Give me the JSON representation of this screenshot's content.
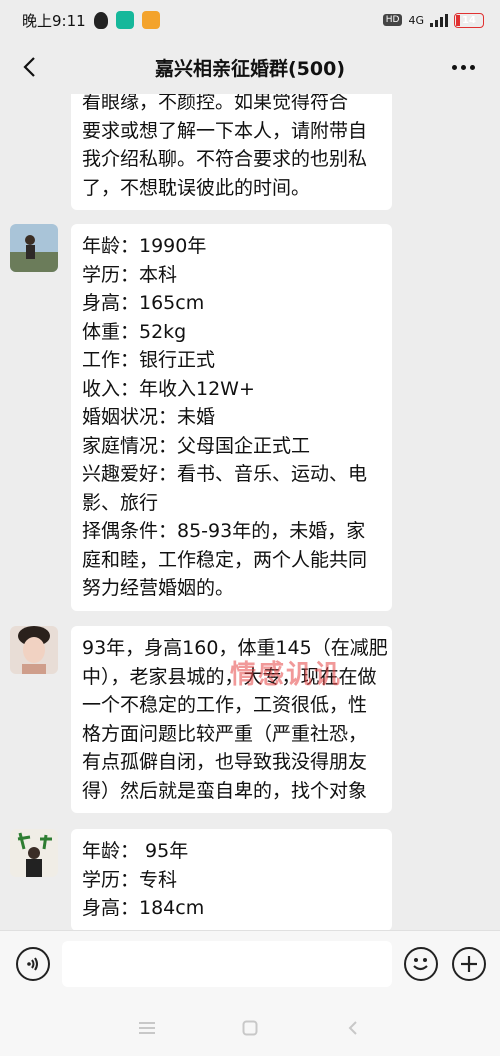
{
  "status_bar": {
    "time": "晚上9:11",
    "hd": "HD",
    "network": "4G",
    "battery": "14",
    "battery_level": 0.14
  },
  "header": {
    "title": "嘉兴相亲征婚群(500)"
  },
  "messages": [
    {
      "lines": [
        "看眼缘，不颜控。如果觉得符合",
        "要求或想了解一下本人，请附带自",
        "我介绍私聊。不符合要求的也别私",
        "了，不想耽误彼此的时间。"
      ]
    },
    {
      "lines": [
        "年龄：1990年",
        "学历：本科",
        "身高：165cm",
        "体重：52kg",
        "工作：银行正式",
        "收入：年收入12W+",
        "婚姻状况：未婚",
        "家庭情况：父母国企正式工",
        "兴趣爱好：看书、音乐、运动、电",
        "影、旅行",
        "择偶条件：85-93年的，未婚，家",
        "庭和睦，工作稳定，两个人能共同",
        "努力经营婚姻的。"
      ]
    },
    {
      "lines": [
        "93年，身高160，体重145（在减肥",
        "中），老家县城的，大专，现在在做",
        "一个不稳定的工作，工资很低，性",
        "格方面问题比较严重（严重社恐，",
        "有点孤僻自闭，也导致我没得朋友",
        "得）然后就是蛮自卑的，找个对象"
      ]
    },
    {
      "lines": [
        "年龄： 95年",
        "学历：专科",
        "身高：184cm"
      ]
    }
  ],
  "watermark": "情感讥讥"
}
